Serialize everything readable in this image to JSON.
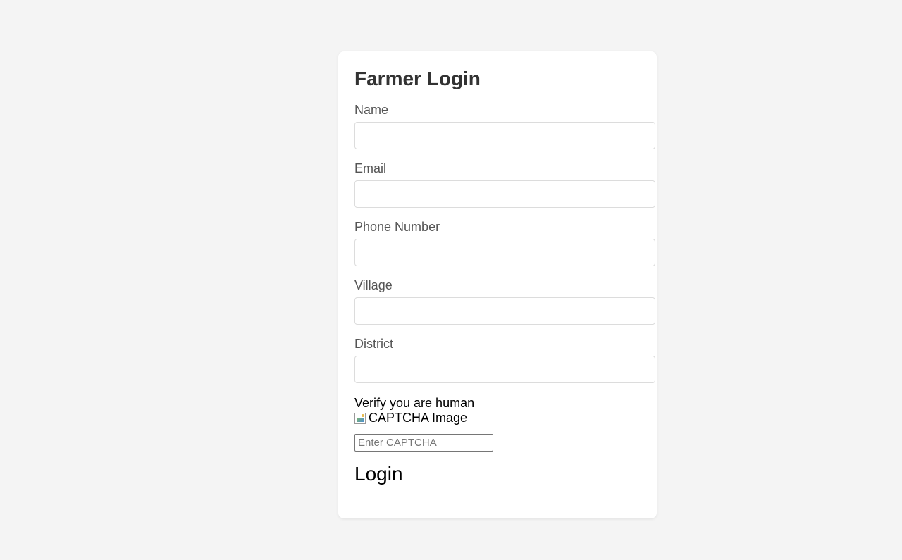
{
  "form": {
    "title": "Farmer Login",
    "fields": [
      {
        "label": "Name",
        "value": ""
      },
      {
        "label": "Email",
        "value": ""
      },
      {
        "label": "Phone Number",
        "value": ""
      },
      {
        "label": "Village",
        "value": ""
      },
      {
        "label": "District",
        "value": ""
      }
    ],
    "captcha": {
      "heading": "Verify you are human",
      "image_alt": "CAPTCHA Image",
      "placeholder": "Enter CAPTCHA"
    },
    "login_label": "Login"
  },
  "colors": {
    "page_background": "#f4f4f4",
    "card_background": "#ffffff",
    "title_text": "#333333",
    "label_text": "#555555",
    "input_border": "#dcdcdc"
  }
}
